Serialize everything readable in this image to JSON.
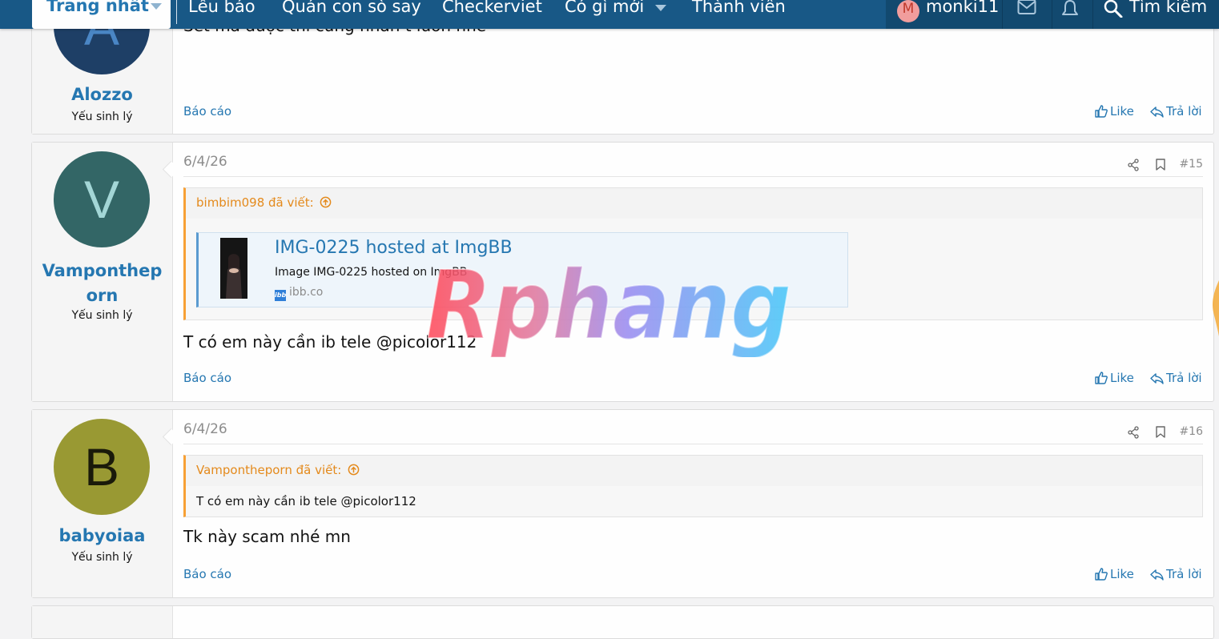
{
  "nav": {
    "home": "Trang nhất",
    "items": [
      "Lều báo",
      "Quán con sò say",
      "Checkerviet",
      "Có gì mới",
      "Thành viên"
    ],
    "user_initial": "M",
    "username": "monki11",
    "search": "Tìm kiếm"
  },
  "posts": [
    {
      "avatar_letter": "A",
      "avatar_color": "#1e3f66",
      "username": "Alozzo",
      "title": "Yếu sinh lý",
      "partial_text": "Set mà được thì cũng nhắn t luôn nhé",
      "report": "Báo cáo",
      "like": "Like",
      "reply": "Trả lời"
    },
    {
      "avatar_letter": "V",
      "avatar_color": "#336666",
      "username_line1": "Vamponthep",
      "username_line2": "orn",
      "title": "Yếu sinh lý",
      "date": "6/4/26",
      "number": "#15",
      "quote_author": "bimbim098 đã viết:",
      "embed": {
        "title": "IMG-0225 hosted at ImgBB",
        "description": "Image IMG-0225 hosted on ImgBB",
        "domain": "ibb.co",
        "domain_icon": "ibb"
      },
      "text": "T có em này cần ib tele @picolor112",
      "report": "Báo cáo",
      "like": "Like",
      "reply": "Trả lời"
    },
    {
      "avatar_letter": "B",
      "avatar_color": "#999933",
      "username": "babyoiaa",
      "title": "Yếu sinh lý",
      "date": "6/4/26",
      "number": "#16",
      "quote_author": "Vampontheporn đã viết:",
      "quote_text": "T có em này cần ib tele @picolor112",
      "text": "Tk này scam nhé mn",
      "report": "Báo cáo",
      "like": "Like",
      "reply": "Trả lời"
    }
  ],
  "watermark": "Rphang",
  "colors": {
    "nav": "#185886",
    "link": "#2577b1",
    "quote_accent": "#f7a035"
  }
}
